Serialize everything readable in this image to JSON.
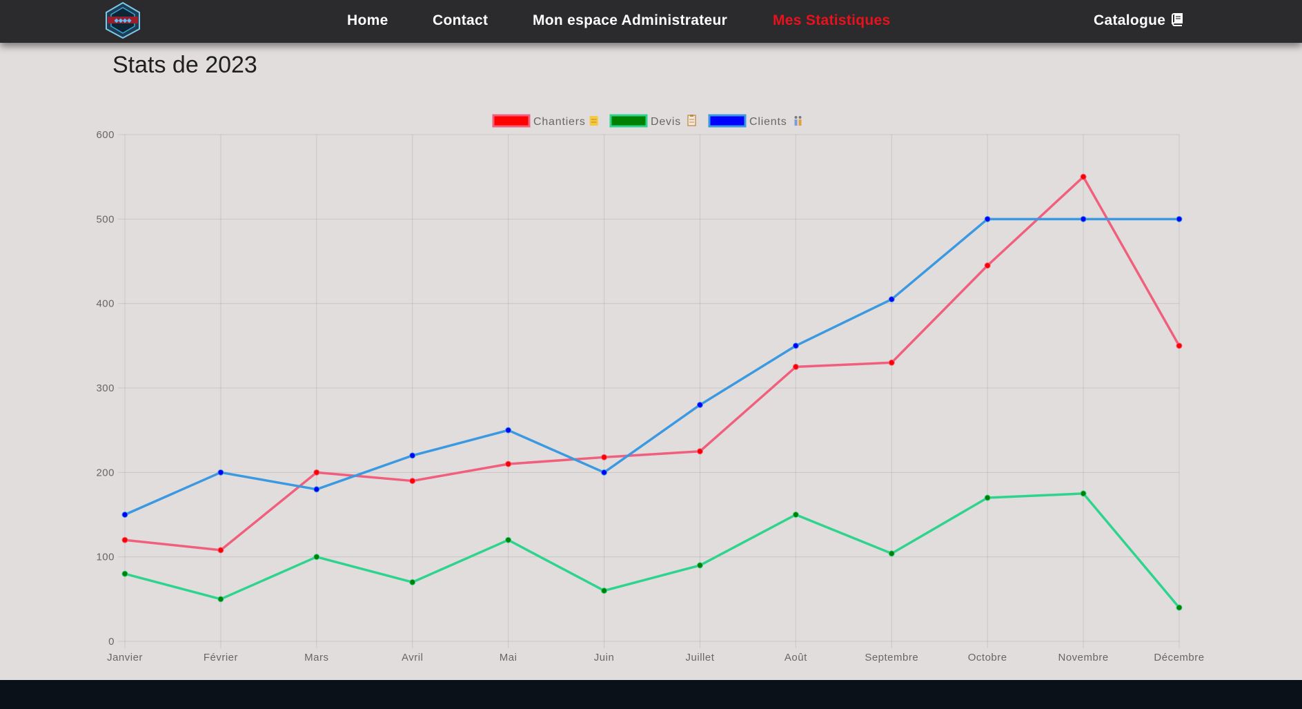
{
  "navbar": {
    "logo_icon": "company-logo-icon",
    "items": [
      {
        "label": "Home"
      },
      {
        "label": "Contact"
      },
      {
        "label": "Mon espace Administrateur"
      },
      {
        "label": "Mes Statistiques",
        "active": true
      }
    ],
    "catalogue": {
      "label": "Catalogue",
      "icon": "book-icon"
    },
    "active_color": "#e8121c"
  },
  "page": {
    "title": "Stats de 2023"
  },
  "chart_data": {
    "type": "line",
    "categories": [
      "Janvier",
      "Février",
      "Mars",
      "Avril",
      "Mai",
      "Juin",
      "Juillet",
      "Août",
      "Septembre",
      "Octobre",
      "Novembre",
      "Décembre"
    ],
    "series": [
      {
        "name": "Chantiers",
        "icon": "notepad-icon",
        "line_color": "#f0607c",
        "point_color": "#ff0000",
        "values": [
          120,
          108,
          200,
          190,
          210,
          218,
          225,
          325,
          330,
          445,
          550,
          350
        ]
      },
      {
        "name": "Devis",
        "icon": "clipboard-icon",
        "line_color": "#2ed48e",
        "point_color": "#008000",
        "values": [
          80,
          50,
          100,
          70,
          120,
          60,
          90,
          150,
          104,
          170,
          175,
          40
        ]
      },
      {
        "name": "Clients",
        "icon": "family-icon",
        "line_color": "#3a99e0",
        "point_color": "#0000ff",
        "values": [
          150,
          200,
          180,
          220,
          250,
          200,
          280,
          350,
          405,
          500,
          500,
          500
        ]
      }
    ],
    "ylim": [
      0,
      600
    ],
    "yticks": [
      "0",
      "100",
      "200",
      "300",
      "400",
      "500",
      "600"
    ],
    "grid": true,
    "legend_position": "top-center"
  }
}
